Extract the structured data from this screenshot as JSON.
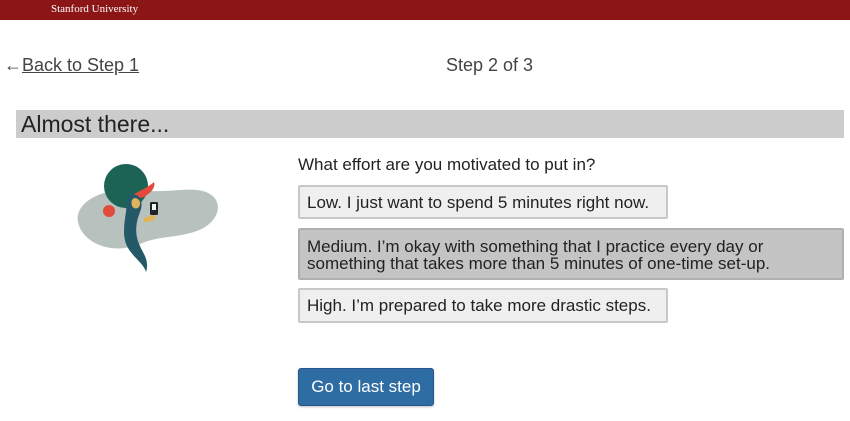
{
  "header": {
    "brand": "Stanford University",
    "color": "#8c1515"
  },
  "nav": {
    "back_arrow": "←",
    "back_label": "Back to Step 1",
    "step_indicator": "Step 2 of 3"
  },
  "section": {
    "title": "Almost there..."
  },
  "illustration": {
    "icon": "person-with-phone-illustration"
  },
  "question": {
    "text": "What effort are you motivated to put in?"
  },
  "options": [
    {
      "title": "Low.",
      "desc": " I just want to spend 5 minutes right now.",
      "selected": false
    },
    {
      "title": "Medium.",
      "desc": " I’m okay with something that I practice every day or something that takes more than 5 minutes of one-time set-up.",
      "selected": true
    },
    {
      "title": "High.",
      "desc": " I’m prepared to take more drastic steps.",
      "selected": false
    }
  ],
  "cta": {
    "label": "Go to last step",
    "color": "#2e6da4"
  }
}
